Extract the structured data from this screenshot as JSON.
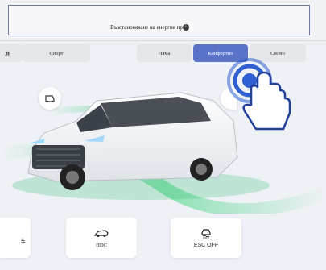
{
  "header": {
    "title": "Възстановяване на енергия пр",
    "info_icon": "info-icon"
  },
  "drive_modes": {
    "partial_label": "准",
    "sport_label": "Спорт"
  },
  "recovery_levels": [
    {
      "label": "Няма",
      "active": false
    },
    {
      "label": "Конфортно",
      "active": true
    },
    {
      "label": "Силно",
      "active": false
    }
  ],
  "scene_icons": {
    "left_circle": "car-camera-icon",
    "right_circle": "partial-icon",
    "gesture": "tap-hand-icon"
  },
  "bottom_controls": [
    {
      "label": "车",
      "icon": "partial-card-icon"
    },
    {
      "label": "HDC",
      "icon": "hill-descent-icon"
    },
    {
      "label": "ESC OFF",
      "icon": "esc-off-icon",
      "icon_caption": "OFF"
    }
  ],
  "colors": {
    "accent": "#5a73c8",
    "gesture_blue": "#2f5fd0",
    "glow_green": "#3ad37a"
  }
}
